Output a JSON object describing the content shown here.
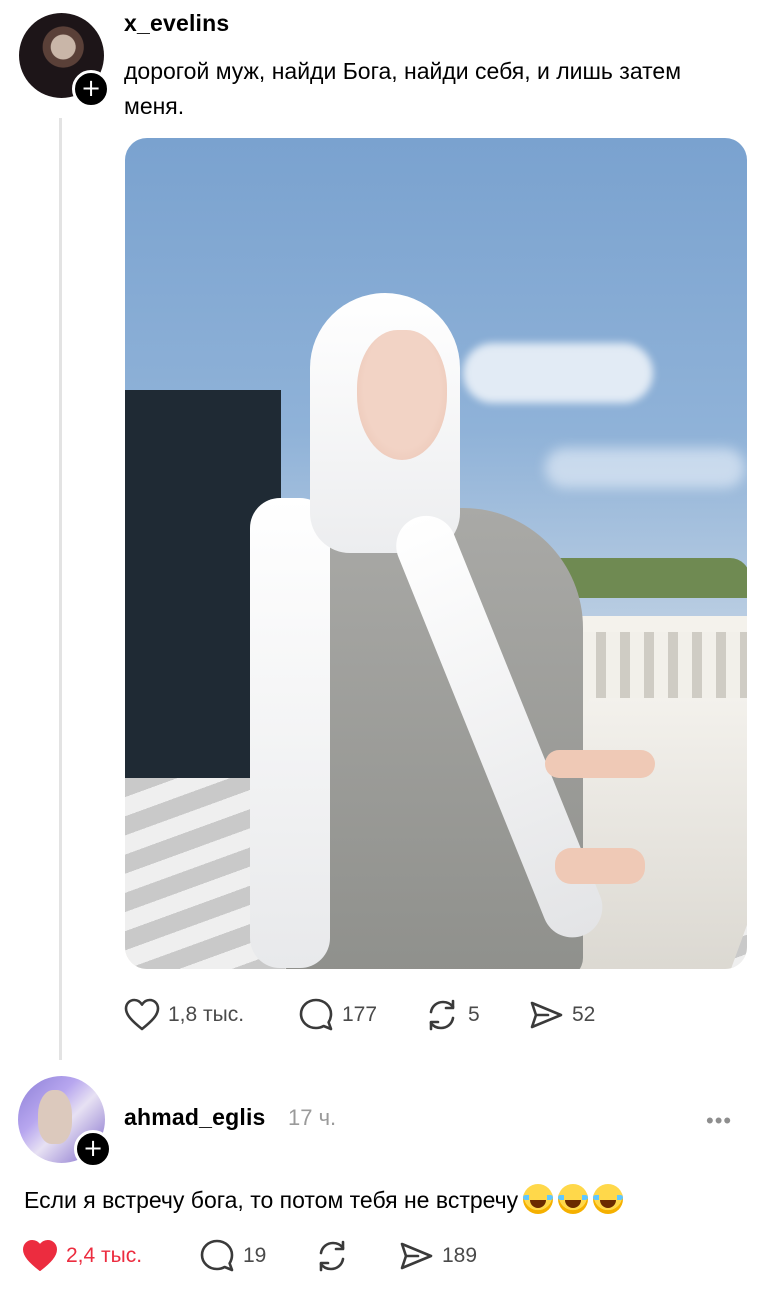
{
  "post": {
    "username": "x_evelins",
    "text": "дорогой муж, найди Бога, найди себя, и лишь затем меня.",
    "actions": {
      "likes": "1,8 тыс.",
      "replies": "177",
      "reposts": "5",
      "shares": "52"
    }
  },
  "reply": {
    "username": "ahmad_eglis",
    "time": "17 ч.",
    "text": "Если я встречу бога, то потом тебя не встречу",
    "actions": {
      "likes": "2,4 тыс.",
      "replies": "19",
      "shares": "189"
    }
  },
  "colors": {
    "like_active": "#ec2c3f",
    "secondary_text": "#9a9a9a"
  },
  "icons": [
    "plus-icon",
    "heart-icon",
    "comment-icon",
    "repost-icon",
    "share-icon",
    "more-icon",
    "laughing-emoji-icon"
  ]
}
